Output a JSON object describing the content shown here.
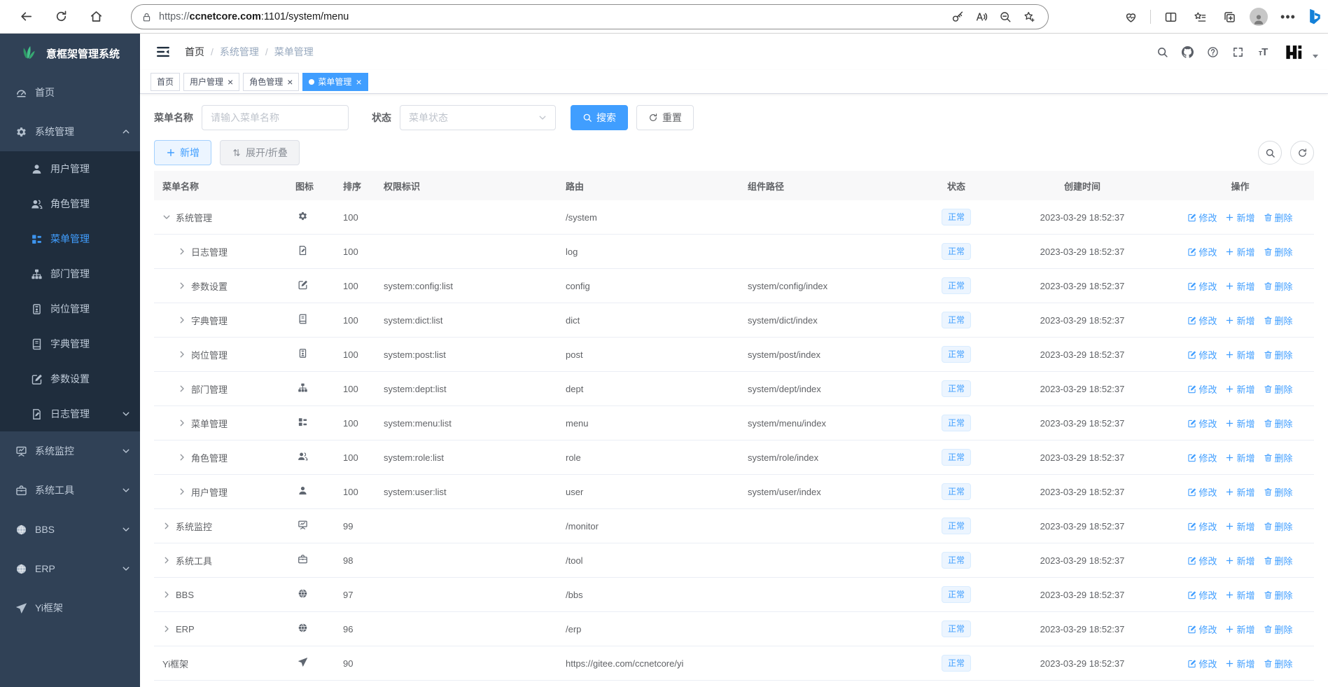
{
  "browser": {
    "nav_icons": [
      "back-icon",
      "reload-icon",
      "home-icon"
    ],
    "url_scheme": "https://",
    "url_domain": "ccnetcore.com",
    "url_path": ":1101/system/menu",
    "pill_right_icons": [
      "key-icon",
      "read-aloud-icon",
      "zoom-out-icon",
      "favorite-star-icon"
    ],
    "right_icons": [
      "essentials-icon",
      "split-screen-icon",
      "favorites-bar-icon",
      "collections-icon",
      "profile-avatar",
      "more-icon",
      "copilot-icon"
    ]
  },
  "sidebar": {
    "title": "意框架管理系统",
    "items": [
      {
        "label": "首页",
        "icon": "dashboard-icon",
        "level": 0
      },
      {
        "label": "系统管理",
        "icon": "gear-icon",
        "level": 0,
        "arrow": "up"
      },
      {
        "label": "用户管理",
        "icon": "user-icon",
        "level": 1
      },
      {
        "label": "角色管理",
        "icon": "users-icon",
        "level": 1
      },
      {
        "label": "菜单管理",
        "icon": "menu-list-icon",
        "level": 1,
        "active": true
      },
      {
        "label": "部门管理",
        "icon": "org-tree-icon",
        "level": 1
      },
      {
        "label": "岗位管理",
        "icon": "badge-icon",
        "level": 1
      },
      {
        "label": "字典管理",
        "icon": "dict-book-icon",
        "level": 1
      },
      {
        "label": "参数设置",
        "icon": "edit-square-icon",
        "level": 1
      },
      {
        "label": "日志管理",
        "icon": "log-icon",
        "level": 1,
        "arrow": "down"
      },
      {
        "label": "系统监控",
        "icon": "monitor-icon",
        "level": 0,
        "arrow": "down"
      },
      {
        "label": "系统工具",
        "icon": "toolbox-icon",
        "level": 0,
        "arrow": "down"
      },
      {
        "label": "BBS",
        "icon": "globe-icon",
        "level": 0,
        "arrow": "down"
      },
      {
        "label": "ERP",
        "icon": "globe-icon",
        "level": 0,
        "arrow": "down"
      },
      {
        "label": "Yi框架",
        "icon": "plane-icon",
        "level": 0
      }
    ]
  },
  "navbar": {
    "breadcrumb": [
      "首页",
      "系统管理",
      "菜单管理"
    ],
    "right_icons": [
      "search-icon",
      "github-icon",
      "question-icon",
      "fullscreen-icon",
      "font-size-icon"
    ]
  },
  "tabs": [
    {
      "label": "首页",
      "active": false,
      "closable": false
    },
    {
      "label": "用户管理",
      "active": false,
      "closable": true
    },
    {
      "label": "角色管理",
      "active": false,
      "closable": true
    },
    {
      "label": "菜单管理",
      "active": true,
      "closable": true
    }
  ],
  "search": {
    "name_label": "菜单名称",
    "name_placeholder": "请输入菜单名称",
    "status_label": "状态",
    "status_placeholder": "菜单状态",
    "search_button": "搜索",
    "reset_button": "重置"
  },
  "toolbar": {
    "add_button": "新增",
    "toggle_button": "展开/折叠"
  },
  "table": {
    "columns": [
      "菜单名称",
      "图标",
      "排序",
      "权限标识",
      "路由",
      "组件路径",
      "状态",
      "创建时间",
      "操作"
    ],
    "op_labels": {
      "edit": "修改",
      "add": "新增",
      "delete": "删除"
    },
    "rows": [
      {
        "name": "系统管理",
        "icon": "gear-icon",
        "expand": "open",
        "level": 0,
        "sort": "100",
        "perm": "",
        "route": "/system",
        "component": "",
        "status": "正常",
        "created": "2023-03-29 18:52:37"
      },
      {
        "name": "日志管理",
        "icon": "log-icon",
        "expand": "closed",
        "level": 1,
        "sort": "100",
        "perm": "",
        "route": "log",
        "component": "",
        "status": "正常",
        "created": "2023-03-29 18:52:37"
      },
      {
        "name": "参数设置",
        "icon": "edit-square-icon",
        "expand": "closed",
        "level": 1,
        "sort": "100",
        "perm": "system:config:list",
        "route": "config",
        "component": "system/config/index",
        "status": "正常",
        "created": "2023-03-29 18:52:37"
      },
      {
        "name": "字典管理",
        "icon": "dict-book-icon",
        "expand": "closed",
        "level": 1,
        "sort": "100",
        "perm": "system:dict:list",
        "route": "dict",
        "component": "system/dict/index",
        "status": "正常",
        "created": "2023-03-29 18:52:37"
      },
      {
        "name": "岗位管理",
        "icon": "badge-icon",
        "expand": "closed",
        "level": 1,
        "sort": "100",
        "perm": "system:post:list",
        "route": "post",
        "component": "system/post/index",
        "status": "正常",
        "created": "2023-03-29 18:52:37"
      },
      {
        "name": "部门管理",
        "icon": "org-tree-icon",
        "expand": "closed",
        "level": 1,
        "sort": "100",
        "perm": "system:dept:list",
        "route": "dept",
        "component": "system/dept/index",
        "status": "正常",
        "created": "2023-03-29 18:52:37"
      },
      {
        "name": "菜单管理",
        "icon": "menu-list-icon",
        "expand": "closed",
        "level": 1,
        "sort": "100",
        "perm": "system:menu:list",
        "route": "menu",
        "component": "system/menu/index",
        "status": "正常",
        "created": "2023-03-29 18:52:37"
      },
      {
        "name": "角色管理",
        "icon": "users-icon",
        "expand": "closed",
        "level": 1,
        "sort": "100",
        "perm": "system:role:list",
        "route": "role",
        "component": "system/role/index",
        "status": "正常",
        "created": "2023-03-29 18:52:37"
      },
      {
        "name": "用户管理",
        "icon": "user-icon",
        "expand": "closed",
        "level": 1,
        "sort": "100",
        "perm": "system:user:list",
        "route": "user",
        "component": "system/user/index",
        "status": "正常",
        "created": "2023-03-29 18:52:37"
      },
      {
        "name": "系统监控",
        "icon": "monitor-icon",
        "expand": "closed",
        "level": 0,
        "sort": "99",
        "perm": "",
        "route": "/monitor",
        "component": "",
        "status": "正常",
        "created": "2023-03-29 18:52:37"
      },
      {
        "name": "系统工具",
        "icon": "toolbox-icon",
        "expand": "closed",
        "level": 0,
        "sort": "98",
        "perm": "",
        "route": "/tool",
        "component": "",
        "status": "正常",
        "created": "2023-03-29 18:52:37"
      },
      {
        "name": "BBS",
        "icon": "globe-icon",
        "expand": "closed",
        "level": 0,
        "sort": "97",
        "perm": "",
        "route": "/bbs",
        "component": "",
        "status": "正常",
        "created": "2023-03-29 18:52:37"
      },
      {
        "name": "ERP",
        "icon": "globe-icon",
        "expand": "closed",
        "level": 0,
        "sort": "96",
        "perm": "",
        "route": "/erp",
        "component": "",
        "status": "正常",
        "created": "2023-03-29 18:52:37"
      },
      {
        "name": "Yi框架",
        "icon": "plane-icon",
        "expand": "none",
        "level": 0,
        "sort": "90",
        "perm": "",
        "route": "https://gitee.com/ccnetcore/yi",
        "component": "",
        "status": "正常",
        "created": "2023-03-29 18:52:37"
      }
    ]
  },
  "colors": {
    "accent": "#409eff",
    "sidebar_bg": "#304156",
    "submenu_bg": "#1f2d3d",
    "status_tag_bg": "#ecf5ff",
    "status_tag_border": "#d9ecff"
  }
}
